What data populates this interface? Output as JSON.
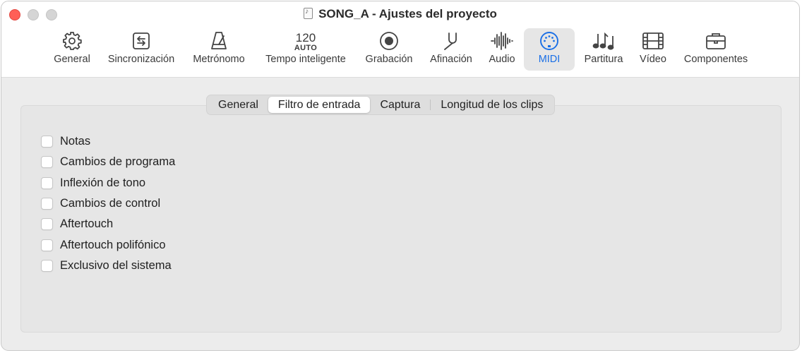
{
  "window": {
    "title": "SONG_A - Ajustes del proyecto",
    "doc_icon": "project-file-icon"
  },
  "toolbar": {
    "items": [
      {
        "label": "General",
        "icon": "gear-icon"
      },
      {
        "label": "Sincronización",
        "icon": "sync-icon"
      },
      {
        "label": "Metrónomo",
        "icon": "metronome-icon"
      },
      {
        "label": "Tempo inteligente",
        "icon": "tempo-readout",
        "tempo": "120",
        "tempo_mode": "AUTO"
      },
      {
        "label": "Grabación",
        "icon": "record-icon"
      },
      {
        "label": "Afinación",
        "icon": "tuning-fork-icon"
      },
      {
        "label": "Audio",
        "icon": "waveform-icon"
      },
      {
        "label": "MIDI",
        "icon": "midi-icon",
        "selected": true
      },
      {
        "label": "Partitura",
        "icon": "notes-icon"
      },
      {
        "label": "Vídeo",
        "icon": "film-icon"
      },
      {
        "label": "Componentes",
        "icon": "briefcase-icon"
      }
    ]
  },
  "tabs": {
    "items": [
      "General",
      "Filtro de entrada",
      "Captura",
      "Longitud de los clips"
    ],
    "selected": "Filtro de entrada"
  },
  "filter": {
    "options": [
      {
        "label": "Notas",
        "checked": false
      },
      {
        "label": "Cambios de programa",
        "checked": false
      },
      {
        "label": "Inflexión de tono",
        "checked": false
      },
      {
        "label": "Cambios de control",
        "checked": false
      },
      {
        "label": "Aftertouch",
        "checked": false
      },
      {
        "label": "Aftertouch polifónico",
        "checked": false
      },
      {
        "label": "Exclusivo del sistema",
        "checked": false
      }
    ]
  },
  "colors": {
    "accent": "#1a6fe6",
    "close": "#ff5f57"
  }
}
